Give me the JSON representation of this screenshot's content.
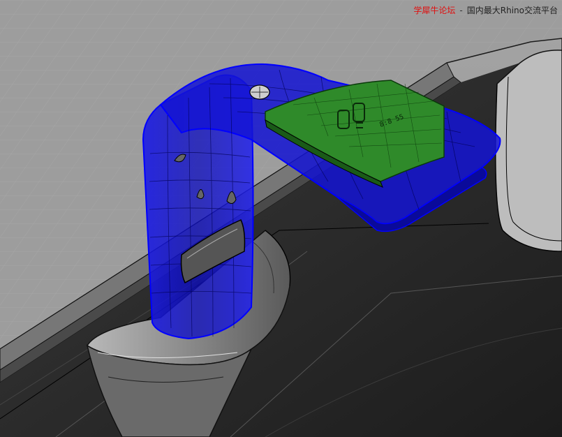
{
  "watermark": {
    "site": "学犀牛论坛",
    "separator": "-",
    "tagline": "国内最大Rhino交流平台"
  },
  "colors": {
    "viewport_background": "#9a9a9a",
    "model_gray": "#2e2e2e",
    "wireframe": "#000000",
    "faucet_blue": "#1010d8",
    "display_green": "#2f8a2a",
    "watermark_red": "#e01010"
  },
  "display_glyphs": "8:8 55"
}
